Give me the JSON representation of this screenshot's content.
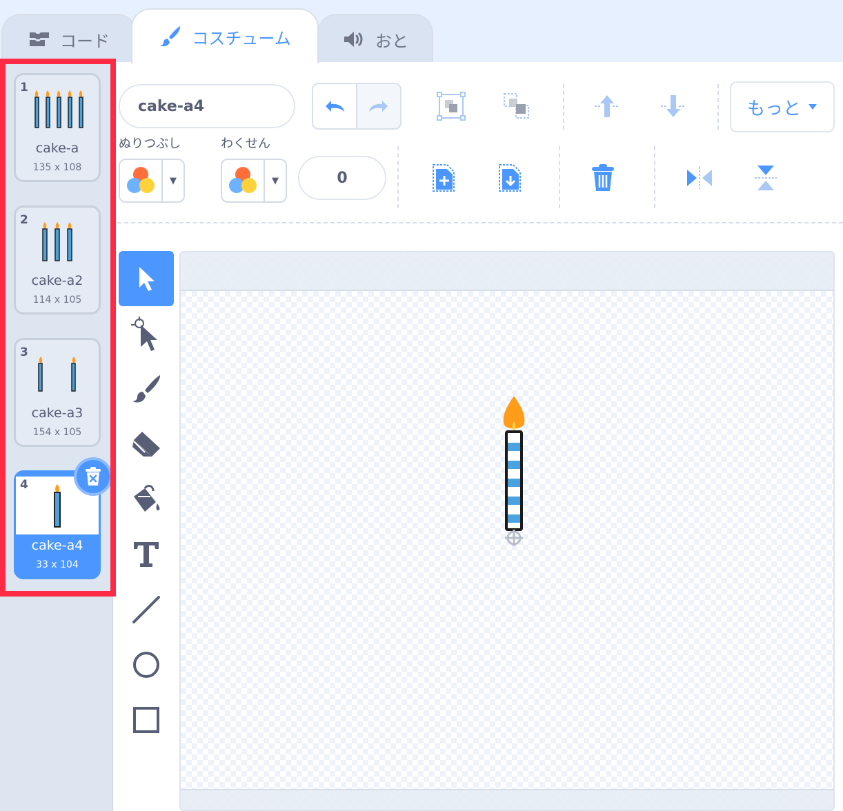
{
  "tabs": [
    {
      "label": "コード",
      "icon": "code-blocks-icon"
    },
    {
      "label": "コスチューム",
      "icon": "paintbrush-icon"
    },
    {
      "label": "おと",
      "icon": "speaker-icon"
    }
  ],
  "costumes": [
    {
      "number": "1",
      "name": "cake-a",
      "size": "135 x 108",
      "candles": 5
    },
    {
      "number": "2",
      "name": "cake-a2",
      "size": "114 x 105",
      "candles": 3
    },
    {
      "number": "3",
      "name": "cake-a3",
      "size": "154 x 105",
      "candles": 2
    },
    {
      "number": "4",
      "name": "cake-a4",
      "size": "33 x 104",
      "candles": 1,
      "selected": true
    }
  ],
  "editor": {
    "costume_name": "cake-a4",
    "more_label": "もっと",
    "fill_label": "ぬりつぶし",
    "outline_label": "わくせん",
    "stroke_width": "0"
  },
  "colors": {
    "accent": "#4c97ff",
    "highlight": "#ff2b44",
    "text": "#575e75"
  }
}
